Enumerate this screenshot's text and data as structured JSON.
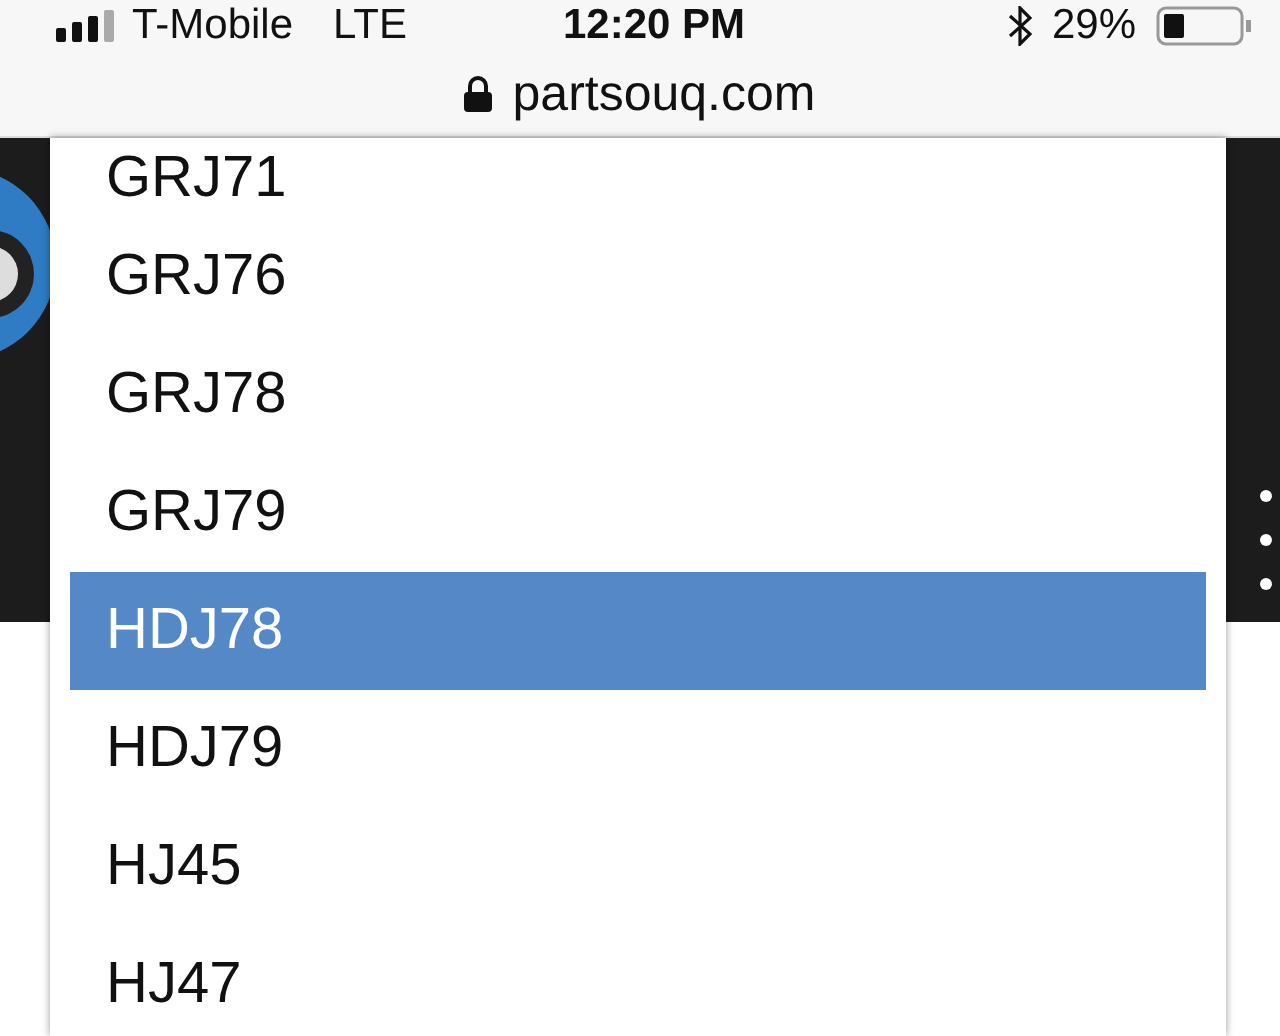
{
  "status_bar": {
    "carrier": "T-Mobile",
    "network": "LTE",
    "time": "12:20 PM",
    "battery": "29%"
  },
  "address_bar": {
    "url": "partsouq.com"
  },
  "dropdown": {
    "options": [
      {
        "label": "GRJ71",
        "selected": false
      },
      {
        "label": "GRJ76",
        "selected": false
      },
      {
        "label": "GRJ78",
        "selected": false
      },
      {
        "label": "GRJ79",
        "selected": false
      },
      {
        "label": "HDJ78",
        "selected": true
      },
      {
        "label": "HDJ79",
        "selected": false
      },
      {
        "label": "HJ45",
        "selected": false
      },
      {
        "label": "HJ47",
        "selected": false
      }
    ]
  }
}
